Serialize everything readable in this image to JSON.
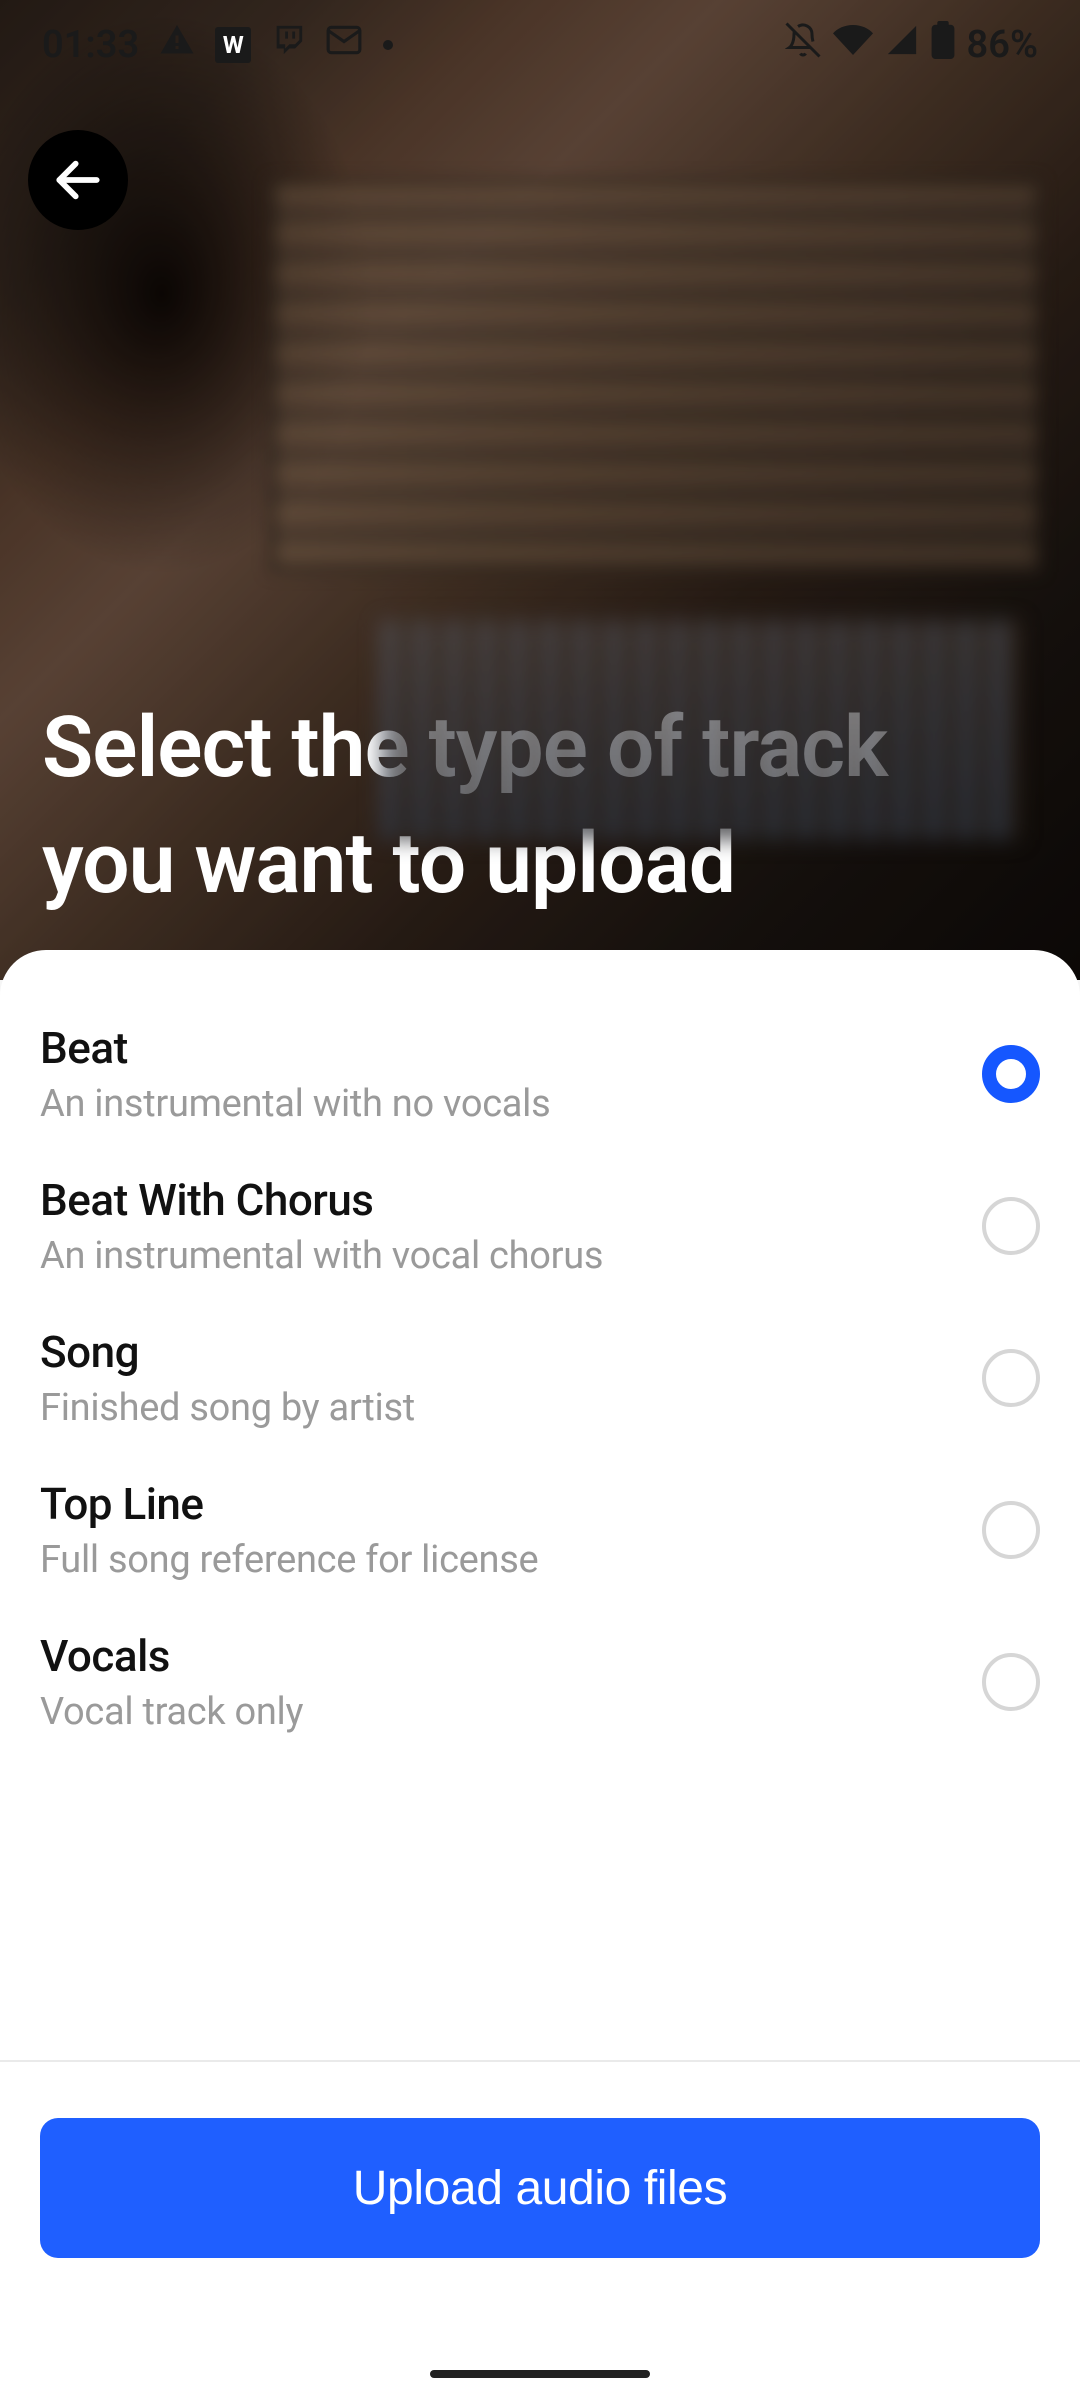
{
  "status_bar": {
    "time": "01:33",
    "battery_text": "86%"
  },
  "header": {
    "title": "Select the type of track you want to upload"
  },
  "options": [
    {
      "title": "Beat",
      "desc": "An instrumental with no vocals",
      "selected": true
    },
    {
      "title": "Beat With Chorus",
      "desc": "An instrumental with vocal chorus",
      "selected": false
    },
    {
      "title": "Song",
      "desc": "Finished song by artist",
      "selected": false
    },
    {
      "title": "Top Line",
      "desc": "Full song reference for license",
      "selected": false
    },
    {
      "title": "Vocals",
      "desc": "Vocal track only",
      "selected": false
    }
  ],
  "actions": {
    "upload_label": "Upload audio files"
  }
}
